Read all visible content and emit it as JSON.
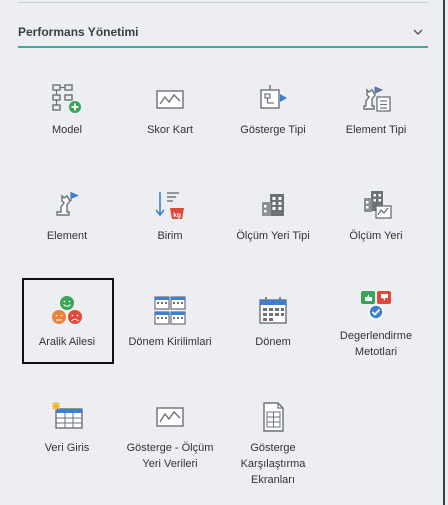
{
  "panel": {
    "title": "Performans Yönetimi"
  },
  "tiles": [
    {
      "label": "Model",
      "icon": "model-icon"
    },
    {
      "label": "Skor Kart",
      "icon": "scorecard-icon"
    },
    {
      "label": "Gösterge Tipi",
      "icon": "indicator-type-icon"
    },
    {
      "label": "Element Tipi",
      "icon": "element-type-icon"
    },
    {
      "label": "Element",
      "icon": "element-icon"
    },
    {
      "label": "Birim",
      "icon": "unit-icon"
    },
    {
      "label": "Ölçüm Yeri Tipi",
      "icon": "measurement-place-type-icon"
    },
    {
      "label": "Ölçüm Yeri",
      "icon": "measurement-place-icon"
    },
    {
      "label": "Aralik Ailesi",
      "icon": "range-family-icon"
    },
    {
      "label": "Dönem Kirilimlari",
      "icon": "period-breakdown-icon"
    },
    {
      "label": "Dönem",
      "icon": "period-icon"
    },
    {
      "label": "Degerlendirme Metotlari",
      "icon": "evaluation-methods-icon"
    },
    {
      "label": "Veri Giris",
      "icon": "data-entry-icon"
    },
    {
      "label": "Gösterge - Ölçüm Yeri Verileri",
      "icon": "indicator-data-icon"
    },
    {
      "label": "Gösterge Karşılaştırma Ekranları",
      "icon": "comparison-screen-icon"
    }
  ],
  "colors": {
    "accent": "#3fa8a0",
    "icon_gray": "#6b7177",
    "icon_blue": "#3b7fd6",
    "icon_green": "#3aa35a",
    "icon_red": "#e0483c",
    "icon_orange": "#e8833a"
  }
}
